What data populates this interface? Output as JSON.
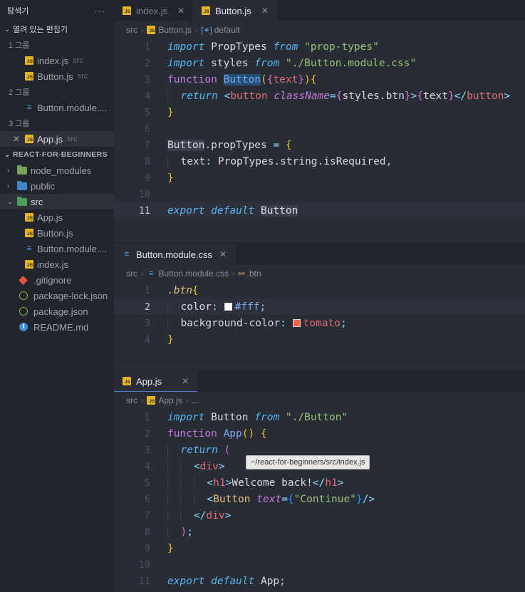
{
  "sidebar": {
    "title": "탐색기",
    "more": "···",
    "open_editors_label": "열려 있는 편집기",
    "groups": [
      {
        "label": "1 그룹",
        "items": [
          {
            "name": "index.js",
            "desc": "src",
            "icon": "js"
          },
          {
            "name": "Button.js",
            "desc": "src",
            "icon": "js"
          }
        ]
      },
      {
        "label": "2 그룹",
        "items": [
          {
            "name": "Button.module....",
            "desc": "",
            "icon": "css"
          }
        ]
      },
      {
        "label": "3 그룹",
        "items": [
          {
            "name": "App.js",
            "desc": "src",
            "icon": "js"
          }
        ]
      }
    ],
    "project_label": "REACT-FOR-BEGINNERS",
    "tree": [
      {
        "name": "node_modules",
        "icon": "folder"
      },
      {
        "name": "public",
        "icon": "folder"
      },
      {
        "name": "src",
        "icon": "folder"
      },
      {
        "name": "App.js",
        "icon": "js"
      },
      {
        "name": "Button.js",
        "icon": "js"
      },
      {
        "name": "Button.module....",
        "icon": "css"
      },
      {
        "name": "index.js",
        "icon": "js"
      },
      {
        "name": ".gitignore",
        "icon": "git"
      },
      {
        "name": "package-lock.json",
        "icon": "npm"
      },
      {
        "name": "package.json",
        "icon": "npm"
      },
      {
        "name": "README.md",
        "icon": "info"
      }
    ]
  },
  "pane1": {
    "tabs": [
      {
        "label": "index.js",
        "close": "✕"
      },
      {
        "label": "Button.js",
        "close": "✕"
      }
    ],
    "crumbs": [
      "src",
      "Button.js",
      "default"
    ],
    "line_numbers": [
      "1",
      "2",
      "3",
      "4",
      "5",
      "6",
      "7",
      "8",
      "9",
      "10",
      "11"
    ]
  },
  "pane2": {
    "tab": {
      "label": "Button.module.css",
      "close": "✕"
    },
    "crumbs": [
      "src",
      "Button.module.css",
      ".btn"
    ],
    "line_numbers": [
      "1",
      "2",
      "3",
      "4"
    ]
  },
  "pane3": {
    "tab": {
      "label": "App.js",
      "close": "✕"
    },
    "crumbs": [
      "src",
      "App.js",
      "..."
    ],
    "line_numbers": [
      "1",
      "2",
      "3",
      "4",
      "5",
      "6",
      "7",
      "8",
      "9",
      "10",
      "11"
    ]
  },
  "tooltip": "~/react-for-beginners/src/index.js",
  "colors": {
    "white_swatch": "#ffffff",
    "tomato_swatch": "#ff6347"
  },
  "code": {
    "import": "import",
    "from": "from",
    "function": "function",
    "return": "return",
    "export": "export",
    "default": "default",
    "PropTypes": "PropTypes",
    "styles": "styles",
    "Button": "Button",
    "App": "App",
    "str_prop_types": "\"prop-types\"",
    "str_module_css": "\"./Button.module.css\"",
    "str_button": "\"./Button\"",
    "str_continue": "\"Continue\"",
    "text": "text",
    "button_tag": "button",
    "className": "className",
    "styles_btn": "styles.btn",
    "propTypes": "propTypes",
    "text_prop": "text",
    "isRequired_chain": "PropTypes.string.isRequired",
    "btn_selector": ".btn",
    "color_prop": "color",
    "bg_prop": "background-color",
    "white_val": "#fff",
    "tomato_val": "tomato",
    "div": "div",
    "h1": "h1",
    "welcome": "Welcome back!",
    "Button_tag": "Button"
  }
}
